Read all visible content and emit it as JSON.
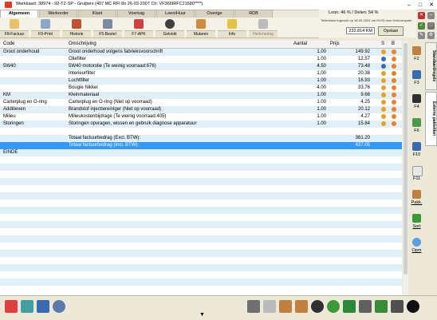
{
  "window": {
    "title": "Werkkaart: 38974 - 92-TZ-SP - Gruijters (407  MC RFI  8n 26-03-2007  Ch: VF36I9RFC21680****)",
    "minimize": "–",
    "maximize": "□",
    "close": "✕"
  },
  "tabs": [
    "Algemeen",
    "Werkorder",
    "Klant",
    "Voertuig",
    "Leen/Huur",
    "Overige",
    "RDB"
  ],
  "toolbar": [
    "F8-Factuur",
    "F9-Print",
    "Historie",
    "F5-Bestel",
    "F7-APK",
    "Gekiokt",
    "Mutaren",
    "Info",
    "Herinnering"
  ],
  "status": {
    "loon": "Loon: 46 % / Delen: 54 %",
    "tellerstand": "Tellerstand ingevuld op 18-09-2024 om 09:03 door Kvikcomputer",
    "km_value": "232.814 KM",
    "opslaan": "Opslaan"
  },
  "grid": {
    "headers": [
      "Code",
      "Omschrijving",
      "Aantal",
      "Prijs",
      "S",
      "B"
    ],
    "rows": [
      {
        "code": "Groot onderhoud",
        "desc": "Groot onderhoud volgens fabrieksvoorschrift",
        "qty": "1.00",
        "price": "149.92"
      },
      {
        "code": "",
        "desc": "Oliefilter",
        "qty": "1.00",
        "price": "12.57"
      },
      {
        "code": "5W40",
        "desc": "5W40 motorolie (Te weinig voorraad:676)",
        "qty": "4.50",
        "price": "73.48"
      },
      {
        "code": "",
        "desc": "Interieurfilter",
        "qty": "1.00",
        "price": "20.38"
      },
      {
        "code": "",
        "desc": "Luchtfilter",
        "qty": "1.00",
        "price": "16.93"
      },
      {
        "code": "",
        "desc": "Bougie Nikkel",
        "qty": "4.00",
        "price": "33.76"
      },
      {
        "code": "KM",
        "desc": "Kleinmateriaal",
        "qty": "1.00",
        "price": "9.68"
      },
      {
        "code": "Carterplug en O-ring",
        "desc": "Carterplug en O-ring (Niet op voorraad)",
        "qty": "1.00",
        "price": "4.25"
      },
      {
        "code": "Additieven",
        "desc": "Brandstof injectiereiniger (Niet op voorraad)",
        "qty": "1.00",
        "price": "20.12"
      },
      {
        "code": "Milieu",
        "desc": "Milieukostenbijdrage (Te weinig voorraad:405)",
        "qty": "1.00",
        "price": "4.27"
      },
      {
        "code": "Storingen",
        "desc": "Storingen opvragen, wissen en gebruik diagnose apparatuur",
        "qty": "1.00",
        "price": "15.84"
      }
    ],
    "total_excl_label": "Totaal factuurbedrag (Excl. BTW):",
    "total_excl_value": "361.20",
    "total_incl_label": "Totaal factuurbedrag (Incl. BTW):",
    "total_incl_value": "437.05",
    "einde": "EINDE"
  },
  "right_panel": [
    "F2",
    "F3",
    "F4",
    "F6",
    "F10",
    "F11",
    "Pakk.",
    "Sort",
    "Opm"
  ],
  "vertical_tabs": [
    "Standaardregels",
    "Externe pakketten"
  ],
  "colors": {
    "selected_row": "#3399ff",
    "alt_row": "#e0eff8"
  }
}
